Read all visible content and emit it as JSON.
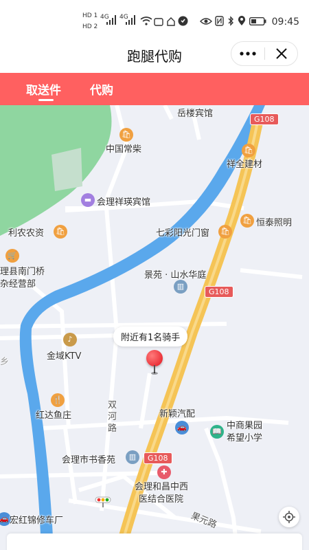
{
  "status_bar": {
    "sim1": "HD 1",
    "sim2": "HD 2",
    "net1": "4G",
    "net2": "4G",
    "time": "09:45"
  },
  "title_bar": {
    "title": "跑腿代购",
    "more_icon": "more-dots-icon",
    "close_icon": "close-icon"
  },
  "tabs": [
    {
      "label": "取送件",
      "active": true
    },
    {
      "label": "代购",
      "active": false
    }
  ],
  "map": {
    "tooltip": "附近有1名骑手",
    "labels": {
      "yuelou": "岳楼宾馆",
      "g108_top": "G108",
      "zhongguo": "中国常柴",
      "xiangquan": "祥全建材",
      "xiangying": "会理祥瑛宾馆",
      "linong": "利农农资",
      "qicai": "七彩阳光门窗",
      "hengtai": "恒泰照明",
      "nanmen1": "理县南门桥",
      "nanmen2": "杂经营部",
      "jingyuan": "景苑 · 山水华庭",
      "g108_mid": "G108",
      "jinyu": "金域KTV",
      "xiang": "乡",
      "hongda": "红达鱼庄",
      "shuanghe": "双河路",
      "xinying": "新颖汽配",
      "school1": "中商果园",
      "school2": "希望小学",
      "shuxiang": "会理市书香苑",
      "g108_bottom": "G108",
      "hospital1": "会理和昌中西",
      "hospital2": "医结合医院",
      "hongjin": "宏红锦修车厂",
      "guoyuan": "果元路"
    },
    "colors": {
      "accent": "#ff6060",
      "river": "#5aa8ec",
      "green": "#8fd6a0",
      "highway": "#f5c456",
      "poi_orange": "#f0a040"
    }
  }
}
